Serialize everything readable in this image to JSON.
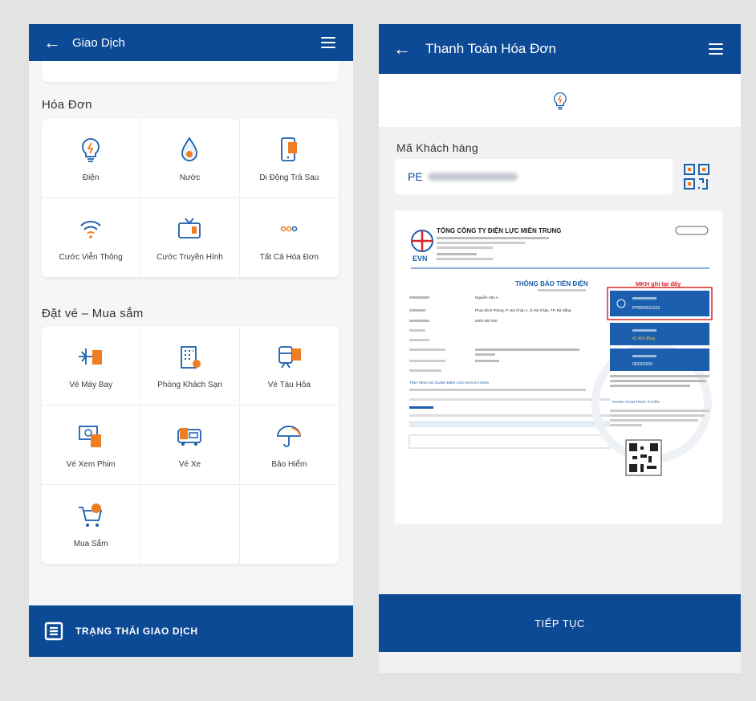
{
  "left_screen": {
    "header": {
      "title": "Giao Dịch"
    },
    "sections": [
      {
        "title": "Hóa Đơn",
        "items": [
          {
            "label": "Điện",
            "icon": "lightbulb-icon"
          },
          {
            "label": "Nước",
            "icon": "water-drop-icon"
          },
          {
            "label": "Di Động Trả Sau",
            "icon": "mobile-phone-icon"
          },
          {
            "label": "Cước Viễn Thông",
            "icon": "wifi-icon"
          },
          {
            "label": "Cước Truyền Hình",
            "icon": "tv-icon"
          },
          {
            "label": "Tất Cả Hóa Đơn",
            "icon": "more-dots-icon"
          }
        ]
      },
      {
        "title": "Đặt vé – Mua sắm",
        "items": [
          {
            "label": "Vé Máy Bay",
            "icon": "airplane-ticket-icon"
          },
          {
            "label": "Phòng Khách Sạn",
            "icon": "hotel-icon"
          },
          {
            "label": "Vé Tàu Hỏa",
            "icon": "train-ticket-icon"
          },
          {
            "label": "Vé Xem Phim",
            "icon": "movie-ticket-icon"
          },
          {
            "label": "Vé Xe",
            "icon": "bus-ticket-icon"
          },
          {
            "label": "Bảo Hiểm",
            "icon": "umbrella-icon"
          },
          {
            "label": "Mua Sắm",
            "icon": "shopping-cart-icon"
          }
        ]
      }
    ],
    "footer": {
      "label": "TRẠNG THÁI GIAO DỊCH"
    }
  },
  "right_screen": {
    "header": {
      "title": "Thanh Toán Hóa Đơn"
    },
    "customer_code": {
      "label": "Mã Khách hàng",
      "value_prefix": "PE"
    },
    "bill": {
      "company": "TỔNG CÔNG TY ĐIỆN LỰC MIỀN TRUNG",
      "logo_text": "EVN",
      "notice_title": "THÔNG BÁO TIỀN ĐIỆN",
      "annotation": "MKH ghi tại đây",
      "customer_name": "Nguyễn Văn A",
      "address": "Phan Đình Phùng, P. Hải Châu 1, Q Hải Châu, TP. Đà Nẵng",
      "phone": "0000 000 000",
      "customer_code": "PP0000011222",
      "amount": "42.452 đồng",
      "due_date": "05/03/2020",
      "section_usage": "TÌNH HÌNH SỬ DỤNG ĐIỆN CỦA KHÁCH HÀNG",
      "section_payment": "THANH TOÁN TRỰC TUYẾN"
    },
    "continue_button": {
      "label": "TIẾP TỤC"
    }
  },
  "colors": {
    "primary": "#0d4a95",
    "accent": "#f07d22",
    "annotation": "#d9262c"
  }
}
